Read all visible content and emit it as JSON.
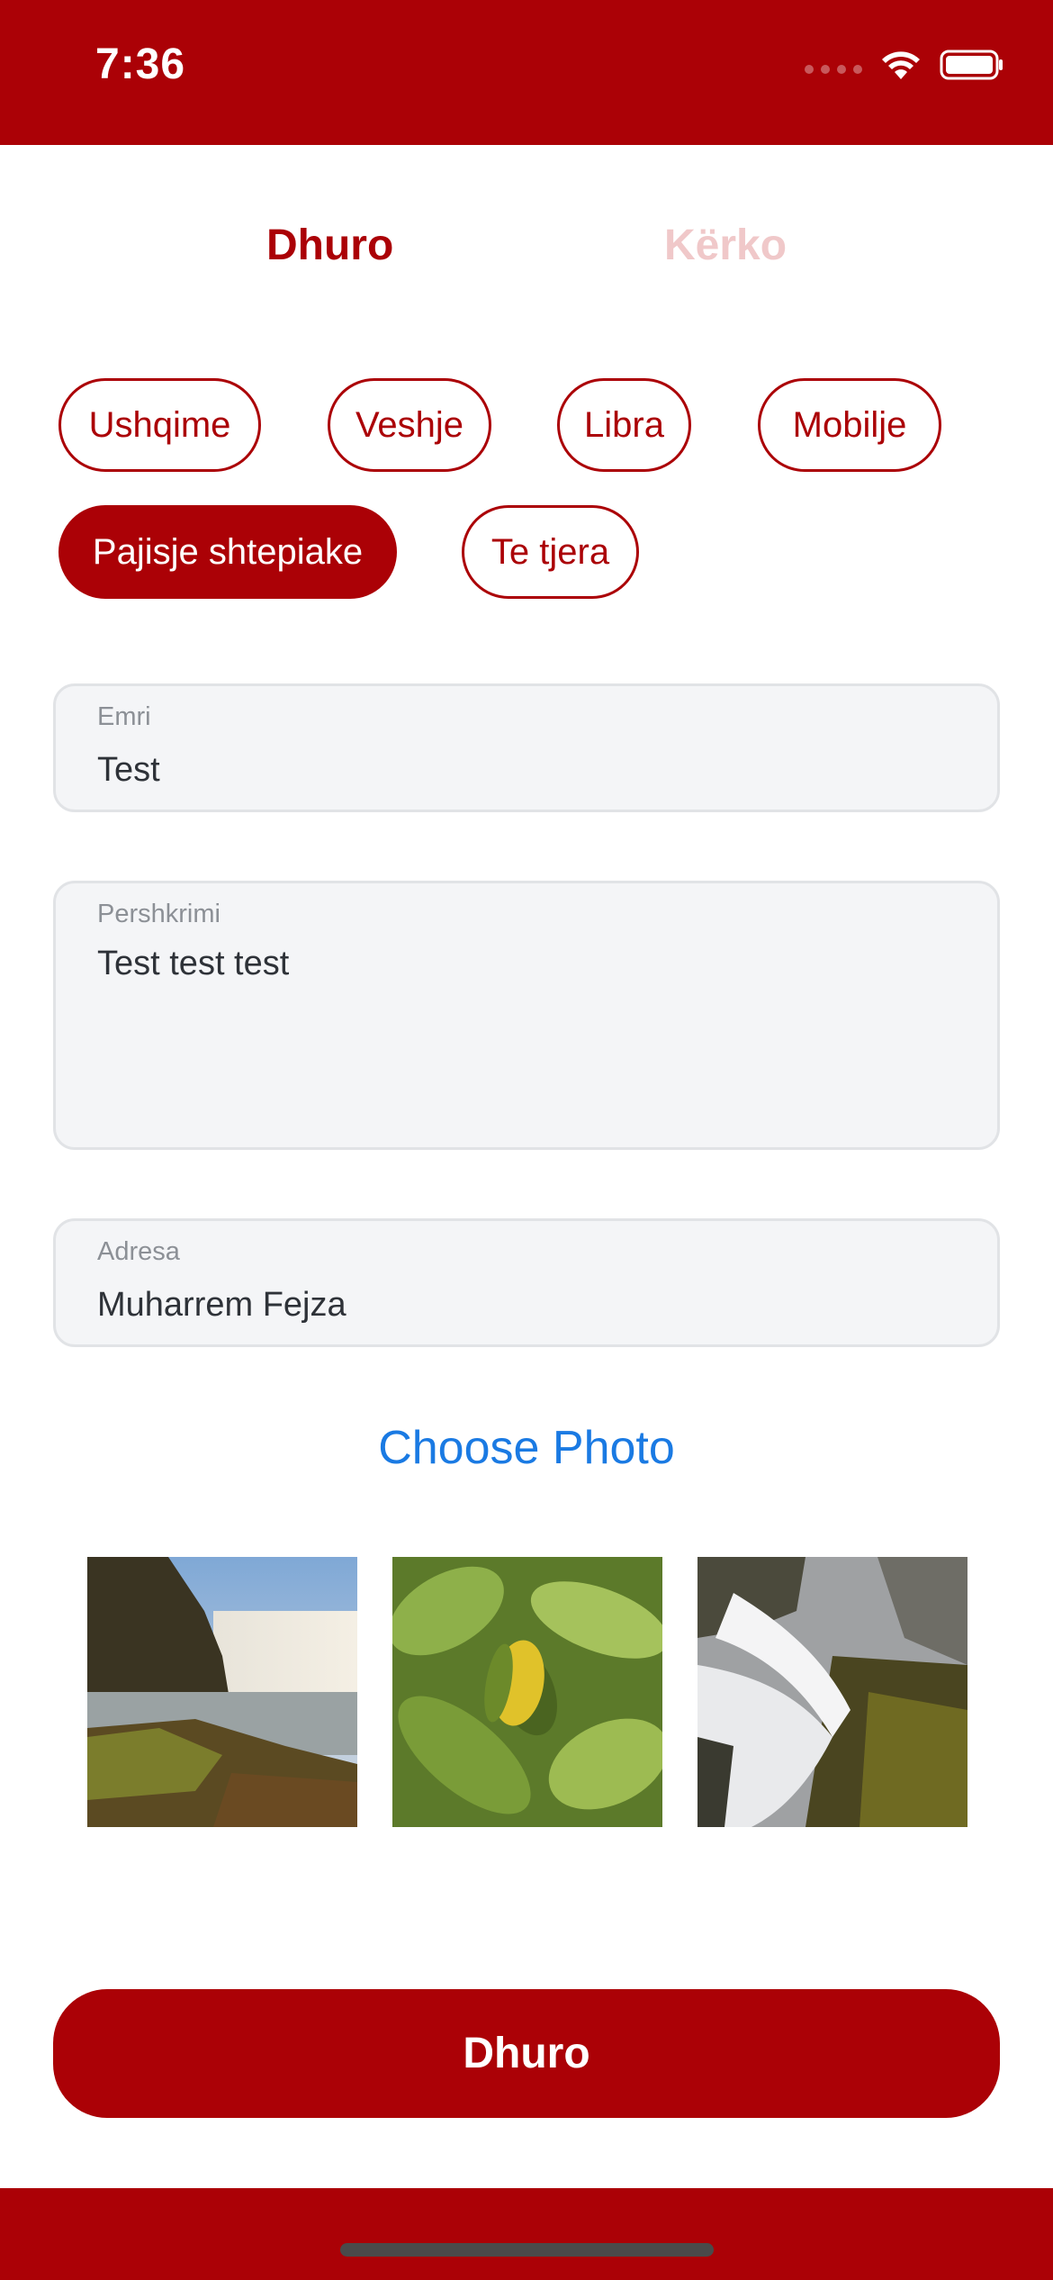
{
  "status_bar": {
    "time": "7:36",
    "icons": [
      "signal-icon",
      "wifi-icon",
      "battery-icon"
    ],
    "background": "#ab0106"
  },
  "tabs": [
    {
      "label": "Dhuro",
      "active": true
    },
    {
      "label": "Kërko",
      "active": false
    }
  ],
  "categories": [
    {
      "label": "Ushqime",
      "selected": false
    },
    {
      "label": "Veshje",
      "selected": false
    },
    {
      "label": "Libra",
      "selected": false
    },
    {
      "label": "Mobilje",
      "selected": false
    },
    {
      "label": "Pajisje shtepiake",
      "selected": true
    },
    {
      "label": "Te tjera",
      "selected": false
    }
  ],
  "form": {
    "name": {
      "label": "Emri",
      "value": "Test"
    },
    "description": {
      "label": "Pershkrimi",
      "value": "Test test test"
    },
    "address": {
      "label": "Adresa",
      "value": "Muharrem Fejza"
    }
  },
  "photos": {
    "choose_label": "Choose Photo",
    "thumbnails": [
      "waterfall-landscape-photo",
      "leaf-with-yellow-fruit-photo",
      "waterfall-rocks-photo"
    ]
  },
  "submit_label": "Dhuro",
  "colors": {
    "accent": "#ab0106",
    "inactive_tab": "#f0c8c9",
    "link": "#1a7ae3",
    "field_background": "#f4f5f7"
  }
}
